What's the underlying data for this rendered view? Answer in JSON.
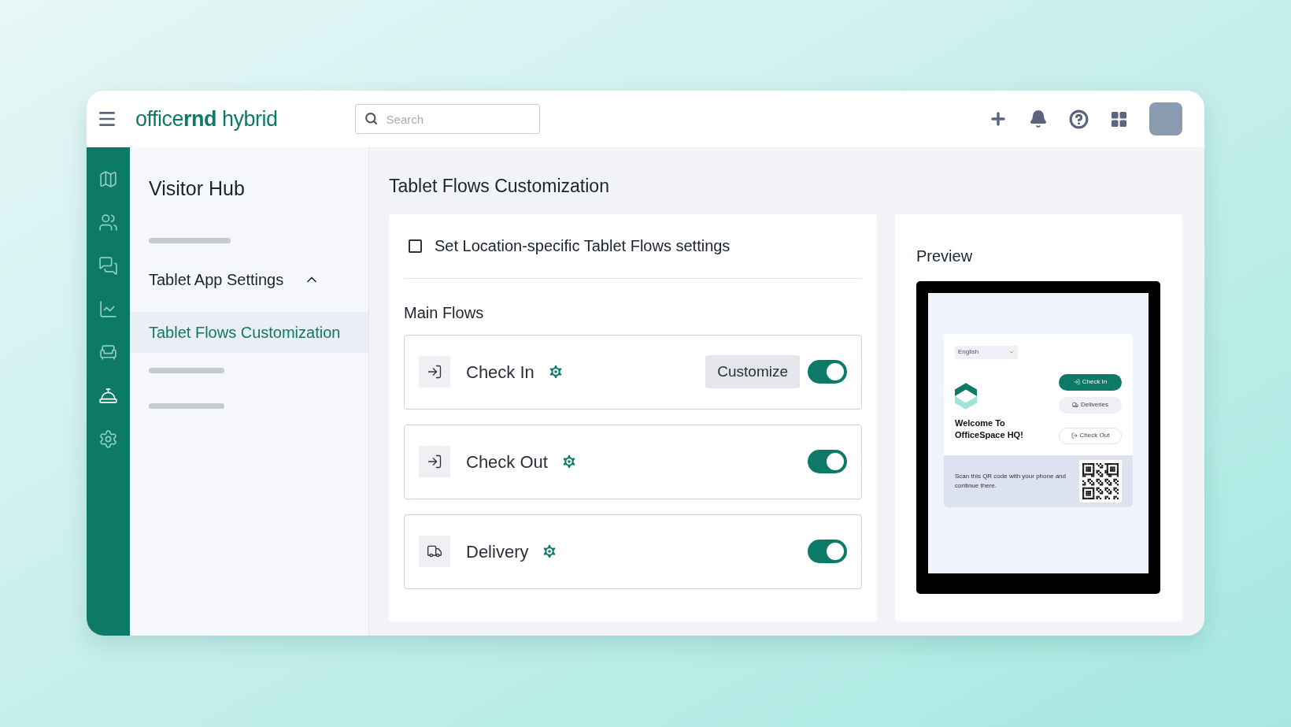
{
  "topbar": {
    "logo": "office**rnd** hybrid",
    "search": {
      "placeholder": "Search"
    }
  },
  "rail": [
    {
      "kind": "map",
      "selected": false
    },
    {
      "kind": "people",
      "selected": false
    },
    {
      "kind": "chat",
      "selected": false
    },
    {
      "kind": "chart",
      "selected": false
    },
    {
      "kind": "desk",
      "selected": false
    },
    {
      "kind": "bell",
      "selected": true
    },
    {
      "kind": "settings",
      "selected": false
    }
  ],
  "nav": {
    "title": "Visitor Hub",
    "items": [
      {
        "kind": "bar"
      },
      {
        "kind": "group",
        "label": "Tablet App Settings",
        "expanded": true,
        "children": [
          {
            "label": "Tablet Flows Customization",
            "selected": true
          }
        ]
      },
      {
        "kind": "bar"
      },
      {
        "kind": "bar"
      }
    ]
  },
  "page": {
    "title": "Tablet Flows Customization",
    "location_specific": {
      "label": "Set Location-specific Tablet Flows settings",
      "checked": false
    },
    "section": "Main Flows",
    "flows": [
      {
        "kind": "checkin",
        "label": "Check In",
        "customize": "Customize",
        "on": true
      },
      {
        "kind": "checkout",
        "label": "Check Out",
        "on": true
      },
      {
        "kind": "delivery",
        "label": "Delivery",
        "on": true
      }
    ]
  },
  "preview": {
    "title": "Preview",
    "language": "English",
    "welcome": "Welcome To OfficeSpace HQ!",
    "buttons": [
      {
        "kind": "checkin",
        "label": "Check In"
      },
      {
        "kind": "delivery",
        "label": "Deliveries"
      },
      {
        "kind": "checkout",
        "label": "Check Out"
      }
    ],
    "qr_text": "Scan this QR code with your phone and continue there."
  }
}
